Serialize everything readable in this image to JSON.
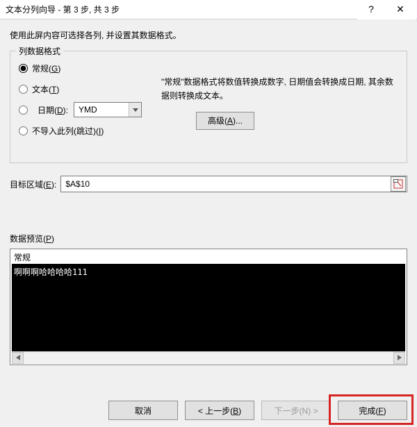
{
  "titlebar": {
    "title": "文本分列向导 - 第 3 步, 共 3 步",
    "help_label": "?",
    "close_label": "✕"
  },
  "instruction": "使用此屏内容可选择各列, 并设置其数据格式。",
  "group": {
    "caption": "列数据格式",
    "radio_general": "常规(G)",
    "radio_text": "文本(T)",
    "radio_date": "日期(D):",
    "radio_skip": "不导入此列(跳过)(I)",
    "date_format": "YMD",
    "hint": "\"常规\"数据格式将数值转换成数字, 日期值会转换成日期, 其余数据则转换成文本。",
    "advanced_label": "高级(A)..."
  },
  "destination": {
    "label": "目标区域(E):",
    "value": "$A$10"
  },
  "preview": {
    "label": "数据预览(P)",
    "col_header": "常规",
    "row1": "啊啊啊哈哈哈哈111"
  },
  "buttons": {
    "cancel": "取消",
    "back": "< 上一步(B)",
    "next": "下一步(N) >",
    "finish": "完成(F)"
  }
}
